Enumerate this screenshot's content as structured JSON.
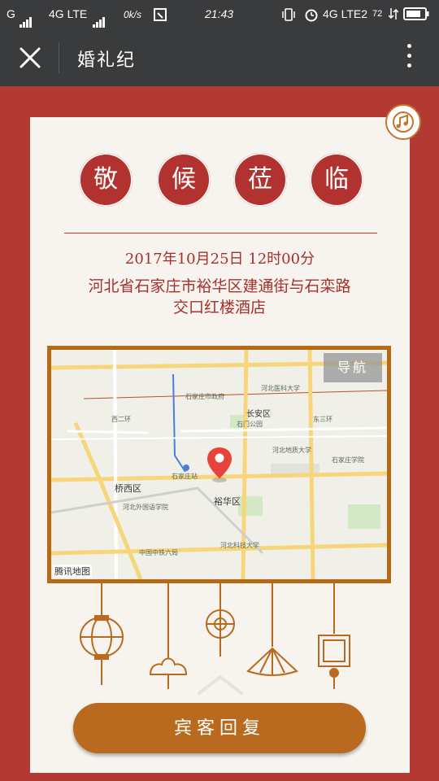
{
  "status_bar": {
    "carrier_left": "G",
    "network_1": "4G LTE",
    "speed": "0k/s",
    "time": "21:43",
    "network_2": "4G LTE2",
    "battery": "72"
  },
  "nav": {
    "title": "婚礼纪",
    "close_icon": "close-icon",
    "more_icon": "more-vertical-icon"
  },
  "invite": {
    "characters": [
      "敬",
      "候",
      "莅",
      "临"
    ],
    "datetime": "2017年10月25日 12时00分",
    "address_line1": "河北省石家庄市裕华区建通街与石栾路",
    "address_line2": "交口红楼酒店"
  },
  "map": {
    "nav_button": "导航",
    "logo_text": "腾讯地图",
    "labels": {
      "yuhua": "裕华区",
      "qiaoxi": "桥西区",
      "changan": "长安区",
      "shimen": "石门公园",
      "zhuanggong": "石家庄站",
      "zhongyuan": "石家庄市政府",
      "kejidaxue": "河北科技大学",
      "waiguoyu": "河北外国语学院",
      "hebei_med": "河北医科大学",
      "shida": "河北地质大学",
      "zhongbei": "中国中铁六局",
      "jiaoxue": "石家庄学院",
      "dongsan": "东三环",
      "xi_er": "西二环"
    }
  },
  "rsvp_button": "宾客回复",
  "colors": {
    "page_red": "#b23a32",
    "accent_red": "#b1322e",
    "gold": "#b96a1e",
    "card": "#f7f4ef"
  }
}
